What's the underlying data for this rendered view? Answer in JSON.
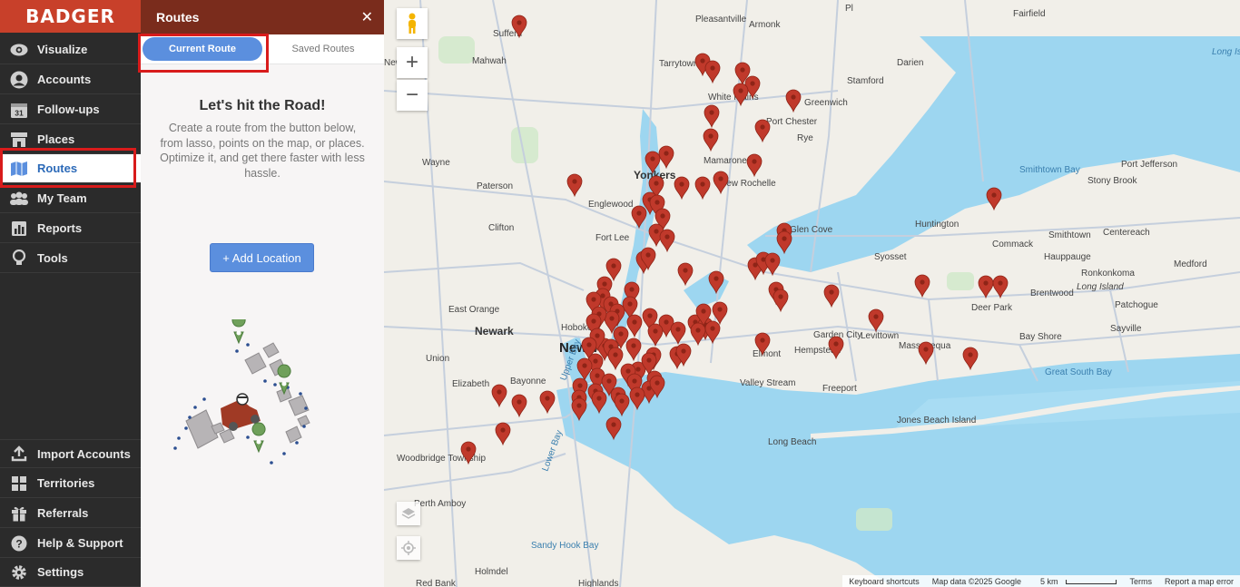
{
  "sidebar": {
    "brand": "BADGER",
    "items": [
      {
        "label": "Visualize"
      },
      {
        "label": "Accounts"
      },
      {
        "label": "Follow-ups"
      },
      {
        "label": "Places"
      },
      {
        "label": "Routes"
      },
      {
        "label": "My Team"
      },
      {
        "label": "Reports"
      },
      {
        "label": "Tools"
      }
    ],
    "bottom_items": [
      {
        "label": "Import Accounts"
      },
      {
        "label": "Territories"
      },
      {
        "label": "Referrals"
      },
      {
        "label": "Help & Support"
      },
      {
        "label": "Settings"
      }
    ],
    "calendar_day": "31"
  },
  "panel": {
    "title": "Routes",
    "close": "✕",
    "tabs": {
      "current": "Current Route",
      "saved": "Saved Routes"
    },
    "empty_title": "Let's hit the Road!",
    "empty_desc": "Create a route from the button below, from lasso, points on the map, or places. Optimize it, and get there faster with less hassle.",
    "add_button": "+ Add Location"
  },
  "map": {
    "labels": [
      "New York",
      "Newark",
      "Yonkers",
      "Paterson",
      "Clifton",
      "Wayne",
      "Englewood",
      "Fort Lee",
      "Hoboken",
      "Bayonne",
      "Elizabeth",
      "Union",
      "East Orange",
      "Tarrytown",
      "White Plains",
      "Stamford",
      "Port Chester",
      "Greenwich",
      "Rye",
      "New Rochelle",
      "Mamaroneck",
      "Glen Cove",
      "Huntington",
      "Syosset",
      "Hempstead",
      "Levittown",
      "Garden City",
      "Freeport",
      "Massapequa",
      "Valley Stream",
      "Long Beach",
      "Jones Beach Island",
      "Hauppauge",
      "Commack",
      "Smithtown",
      "Brentwood",
      "Deer Park",
      "Bay Shore",
      "Sayville",
      "Patchogue",
      "Centereach",
      "Stony Brook",
      "Port Jefferson",
      "Ronkonkoma",
      "Medford",
      "Long Island",
      "Smithtown Bay",
      "Great South Bay",
      "Woodbridge Township",
      "Perth Amboy",
      "Sandy Hook Bay",
      "Lower Bay",
      "Highlands",
      "Red Bank",
      "Holmdel",
      "Darien",
      "New City",
      "Pleasantville",
      "Armonk",
      "Fairfield",
      "Mahwah",
      "Suffern",
      "Long Isl",
      "Upper Bay",
      "Elmont",
      "Pl"
    ],
    "marker_color": "#c0392b",
    "attribution": [
      "Keyboard shortcuts",
      "Map data ©2025 Google",
      "5 km",
      "Terms",
      "Report a map error"
    ]
  }
}
